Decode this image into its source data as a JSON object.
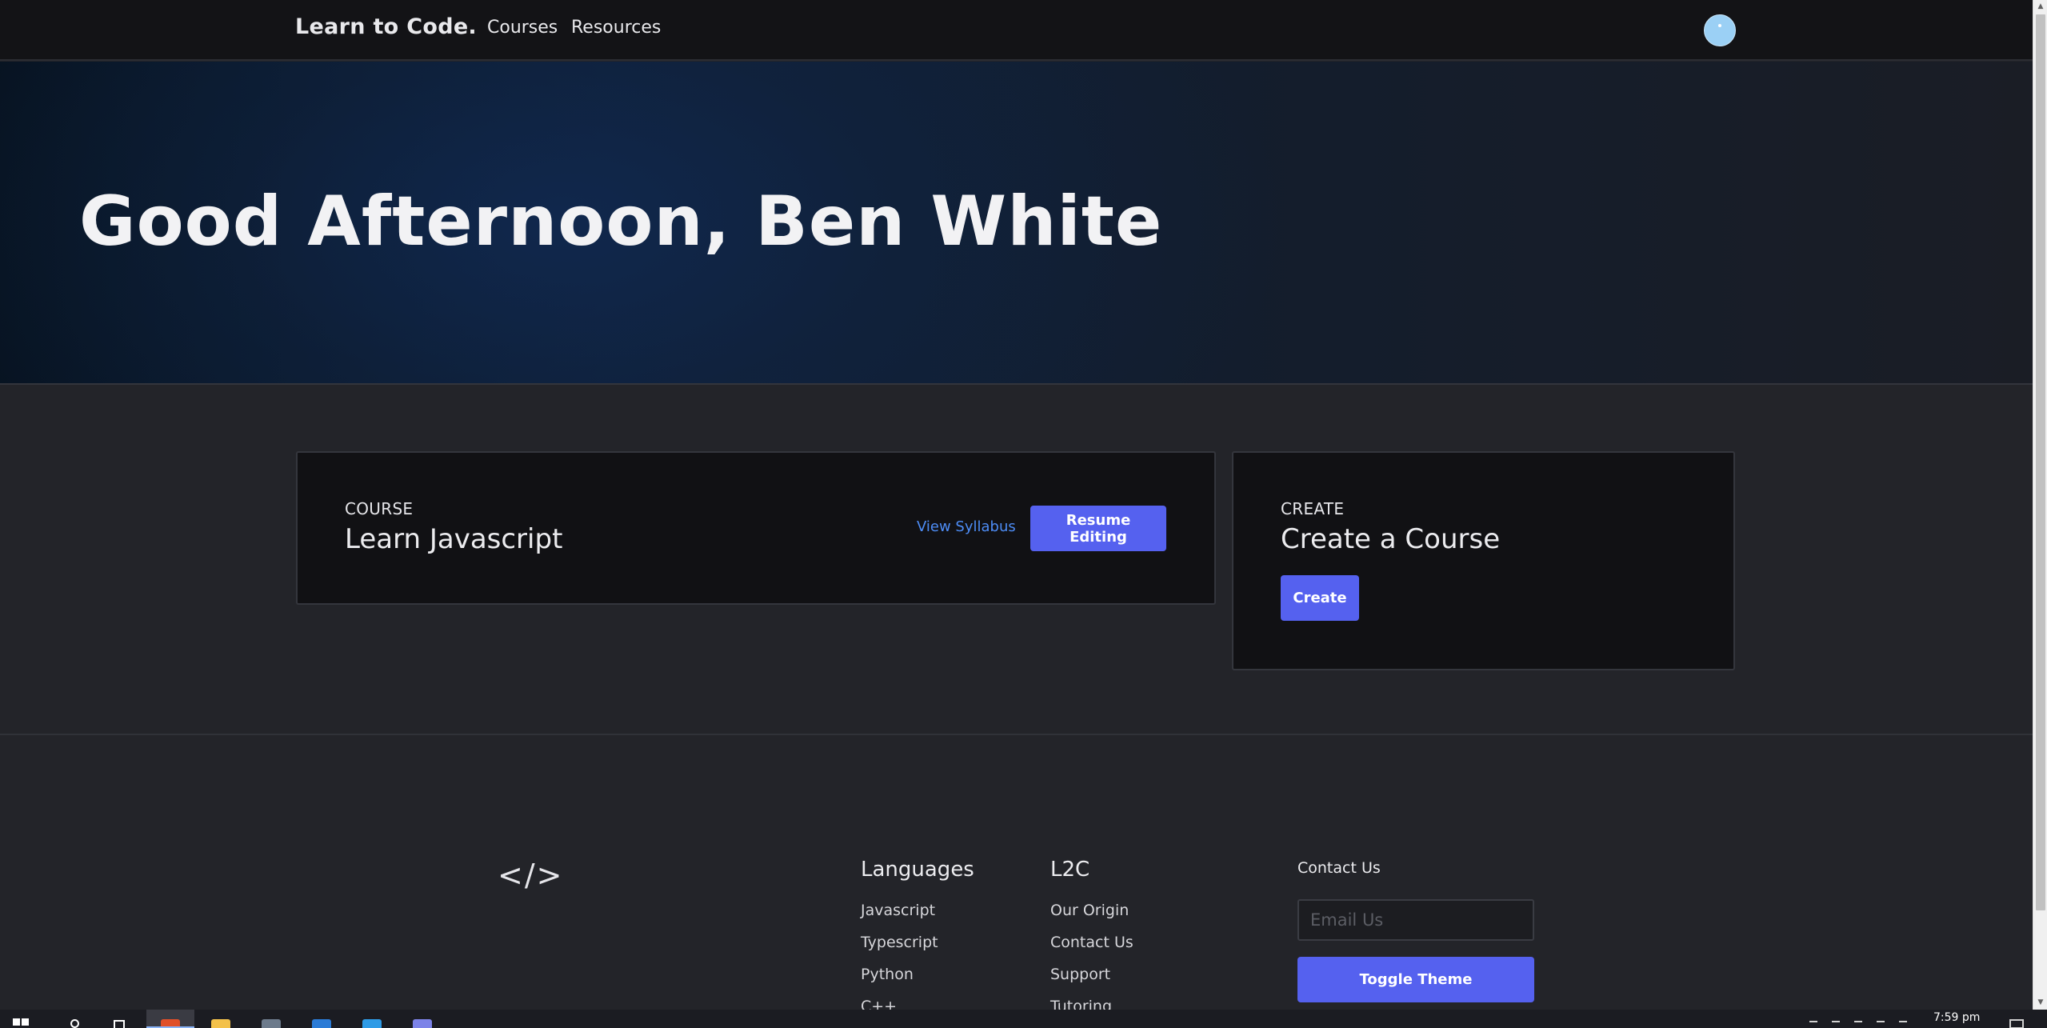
{
  "navbar": {
    "brand": "Learn to Code.",
    "links": [
      "Courses",
      "Resources"
    ]
  },
  "hero": {
    "greeting": "Good Afternoon, Ben White"
  },
  "course_card": {
    "kicker": "COURSE",
    "title": "Learn Javascript",
    "view_syllabus_label": "View Syllabus",
    "resume_label": "Resume Editing"
  },
  "create_card": {
    "kicker": "CREATE",
    "title": "Create a Course",
    "create_label": "Create"
  },
  "footer": {
    "logo": "</>",
    "languages": {
      "title": "Languages",
      "items": [
        "Javascript",
        "Typescript",
        "Python",
        "C++"
      ]
    },
    "l2c": {
      "title": "L2C",
      "items": [
        "Our Origin",
        "Contact Us",
        "Support",
        "Tutoring"
      ]
    },
    "contact": {
      "title": "Contact Us",
      "email_placeholder": "Email Us",
      "toggle_theme_label": "Toggle Theme"
    }
  },
  "taskbar": {
    "clock": "7:59 pm",
    "apps": [
      {
        "icon": "brave-browser-icon",
        "color": "#e0502a",
        "active": true
      },
      {
        "icon": "file-explorer-icon",
        "color": "#f3c14b",
        "active": false
      },
      {
        "icon": "app-icon",
        "color": "#6d7b8c",
        "active": false
      },
      {
        "icon": "mail-icon",
        "color": "#2b7bd6",
        "active": false
      },
      {
        "icon": "vscode-icon",
        "color": "#2f9be6",
        "active": false
      },
      {
        "icon": "notes-icon",
        "color": "#7c83e8",
        "active": false
      }
    ]
  },
  "colors": {
    "accent": "#5561ef",
    "link": "#4d8cf5",
    "avatar": "#9bd0f5"
  }
}
